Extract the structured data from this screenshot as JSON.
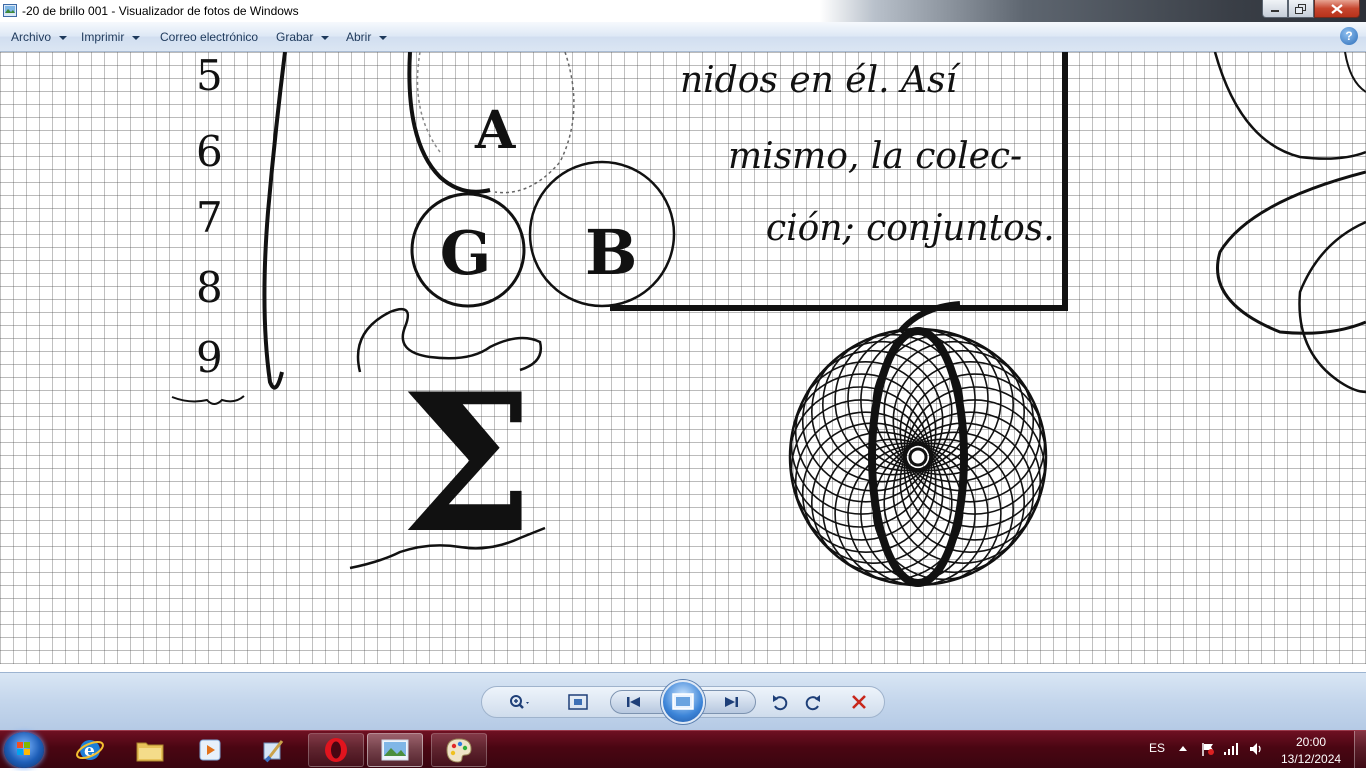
{
  "window": {
    "title": "-20 de brillo 001 - Visualizador de fotos de Windows",
    "icon": "photo-viewer-icon"
  },
  "menu": {
    "items": [
      "Archivo",
      "Imprimir",
      "Correo electrónico",
      "Grabar",
      "Abrir"
    ],
    "help_label": "?"
  },
  "image": {
    "numbers": [
      "5",
      "6",
      "7",
      "8",
      "9"
    ],
    "circles": [
      "A",
      "G",
      "B"
    ],
    "text_lines": [
      "nidos en él. Así",
      "mismo, la colec-",
      "ción; conjuntos."
    ],
    "sigma": "Σ"
  },
  "controls": {
    "zoom": "zoom-icon",
    "fit": "fit-to-window-icon",
    "previous": "previous-icon",
    "slideshow": "slideshow-icon",
    "next": "next-icon",
    "rotate_left": "rotate-counterclockwise-icon",
    "rotate_right": "rotate-clockwise-icon",
    "delete": "delete-icon"
  },
  "taskbar": {
    "language": "ES",
    "time": "20:00",
    "date": "13/12/2024",
    "apps": [
      "internet-explorer",
      "file-explorer",
      "media-player",
      "paint-brush",
      "opera",
      "photo-viewer",
      "paint"
    ]
  },
  "colors": {
    "menubar": "#dbe6f3",
    "taskbar": "#4a0612",
    "close_button": "#c7462e"
  }
}
